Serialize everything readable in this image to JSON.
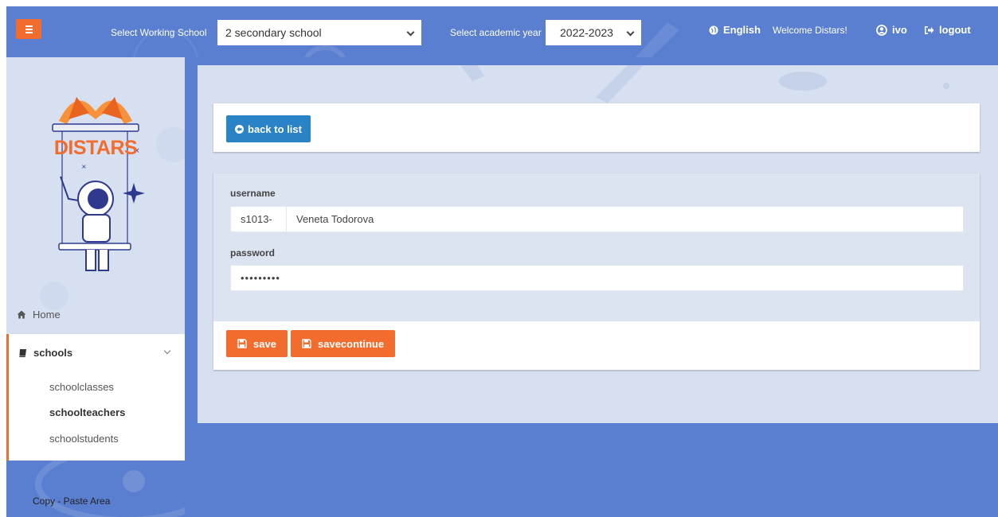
{
  "topbar": {
    "school_label": "Select Working School",
    "school_value": "2 secondary school",
    "year_label": "Select academic year",
    "year_value": "2022-2023",
    "language": "English",
    "welcome": "Welcome Distars!",
    "user": "ivo",
    "logout": "logout"
  },
  "sidebar": {
    "logo_text": "DISTARS",
    "home": "Home",
    "group": "schools",
    "sub_items": [
      "schoolclasses",
      "schoolteachers",
      "schoolstudents"
    ],
    "active_item": "schoolteachers",
    "copy_paste": "Copy - Paste Area"
  },
  "main": {
    "back_button": "back to list",
    "username_label": "username",
    "username_prefix": "s1013-",
    "username_value": "Veneta Todorova",
    "password_label": "password",
    "password_value": "•••••••••",
    "save_button": "save",
    "savecontinue_button": "savecontinue"
  },
  "colors": {
    "brand_blue": "#5a7fd0",
    "accent_orange": "#f26c2d",
    "button_blue": "#2a83c5",
    "panel_light": "#d7e0f1"
  }
}
